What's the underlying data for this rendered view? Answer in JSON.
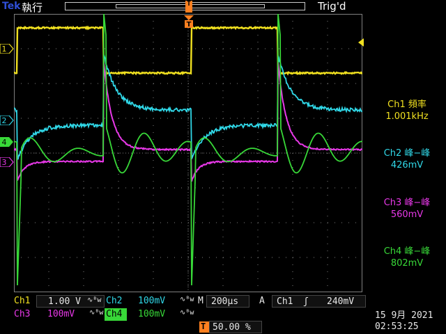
{
  "header": {
    "brand": "Tek",
    "status": "執行",
    "trigger_state": "Trig'd",
    "trigger_pos_marker": "T"
  },
  "markers": {
    "ch1": "1",
    "ch2": "2",
    "ch3": "3",
    "ch4": "4",
    "trigger_time": "T"
  },
  "colors": {
    "ch1": "#f0e020",
    "ch2": "#30d8e8",
    "ch3": "#e838e8",
    "ch4": "#38d838",
    "trigger": "#ff8020",
    "graticule": "#808080"
  },
  "measurements": [
    {
      "label": "Ch1 頻率",
      "value": "1.001kHz",
      "color": "#f0e020"
    },
    {
      "label": "Ch2 峰−峰",
      "value": "426mV",
      "color": "#30d8e8"
    },
    {
      "label": "Ch3 峰−峰",
      "value": "560mV",
      "color": "#e838e8"
    },
    {
      "label": "Ch4 峰−峰",
      "value": "802mV",
      "color": "#38d838"
    }
  ],
  "settings": {
    "ch1": {
      "name": "Ch1",
      "scale": "1.00 V",
      "bw": "∿ᴮw"
    },
    "ch2": {
      "name": "Ch2",
      "scale": "100mV",
      "bw": "∿ᴮw"
    },
    "ch3": {
      "name": "Ch3",
      "scale": "100mV",
      "bw": "∿ᴮw"
    },
    "ch4": {
      "name": "Ch4",
      "scale": "100mV",
      "bw": "∿ᴮw"
    },
    "timebase_prefix": "M",
    "timebase": "200µs",
    "trigger_prefix": "A",
    "trigger_source": "Ch1",
    "trigger_slope": "ʃ",
    "trigger_level": "240mV",
    "trigger_pos_icon": "T",
    "trigger_position": "50.00 %"
  },
  "datetime": {
    "date": "15 9月  2021",
    "time": "02:53:25"
  }
}
